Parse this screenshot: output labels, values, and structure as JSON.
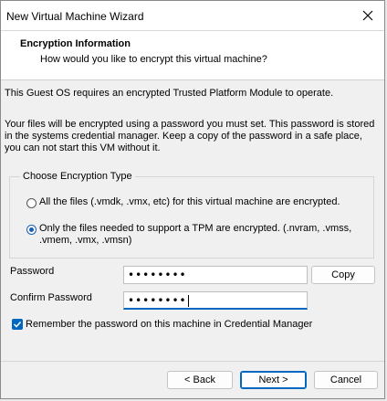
{
  "window": {
    "title": "New Virtual Machine Wizard"
  },
  "header": {
    "title": "Encryption Information",
    "subtitle": "How would you like to encrypt this virtual machine?"
  },
  "intro_text": "This Guest OS requires an encrypted Trusted Platform Module to operate.",
  "description_text": "Your files will be encrypted using a password you must set. This password is stored in the systems credential manager. Keep a copy of the password in a safe place, you can not start this VM without it.",
  "encryption_type": {
    "legend": "Choose Encryption Type",
    "options": [
      {
        "label": "All the files (.vmdk, .vmx, etc) for this virtual machine are encrypted.",
        "selected": false
      },
      {
        "label": "Only the files needed to support a TPM are encrypted. (.nvram, .vmss, .vmem, .vmx, .vmsn)",
        "selected": true
      }
    ]
  },
  "password": {
    "label": "Password",
    "value": "••••••••"
  },
  "confirm_password": {
    "label": "Confirm Password",
    "value": "••••••••"
  },
  "copy_button": "Copy",
  "remember_checkbox": {
    "label": "Remember the password on this machine in Credential Manager",
    "checked": true
  },
  "buttons": {
    "back": "< Back",
    "next": "Next >",
    "cancel": "Cancel"
  },
  "colors": {
    "accent": "#0067c0"
  },
  "icons": {
    "close": "close-icon",
    "check": "checkmark-icon"
  }
}
